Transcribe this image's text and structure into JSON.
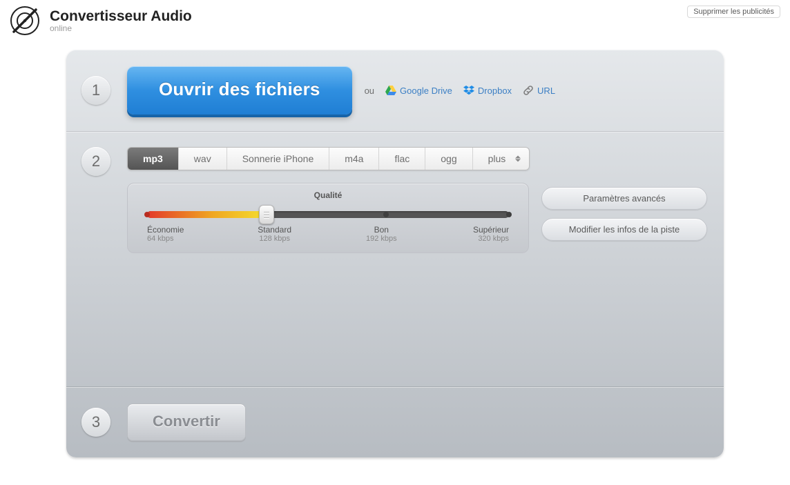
{
  "header": {
    "title": "Convertisseur Audio",
    "subtitle": "online",
    "remove_ads": "Supprimer les publicités"
  },
  "step1": {
    "open_btn": "Ouvrir des fichiers",
    "or": "ou",
    "gdrive": "Google Drive",
    "dropbox": "Dropbox",
    "url": "URL"
  },
  "formats": {
    "tabs": [
      "mp3",
      "wav",
      "Sonnerie iPhone",
      "m4a",
      "flac",
      "ogg",
      "plus"
    ],
    "active": "mp3"
  },
  "quality": {
    "title": "Qualité",
    "labels": [
      {
        "name": "Économie",
        "rate": "64 kbps"
      },
      {
        "name": "Standard",
        "rate": "128 kbps"
      },
      {
        "name": "Bon",
        "rate": "192 kbps"
      },
      {
        "name": "Supérieur",
        "rate": "320 kbps"
      }
    ],
    "selected_index": 1
  },
  "side": {
    "advanced": "Paramètres avancés",
    "track_info": "Modifier les infos de la piste"
  },
  "step3": {
    "convert": "Convertir"
  },
  "step_numbers": [
    "1",
    "2",
    "3"
  ]
}
